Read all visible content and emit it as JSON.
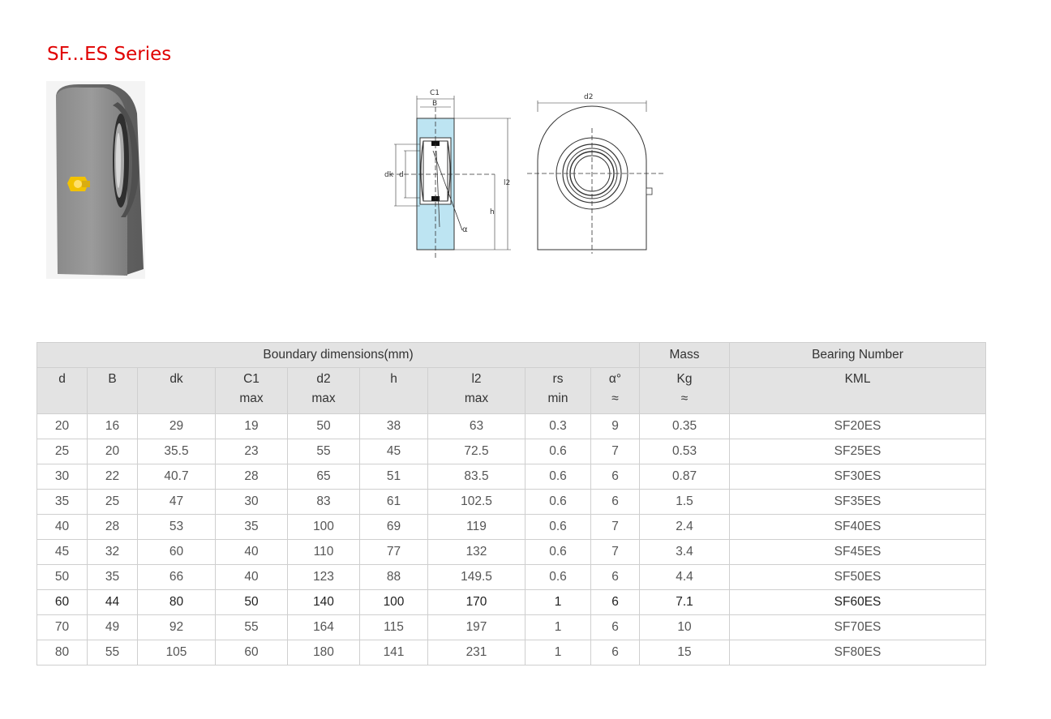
{
  "title": "SF...ES Series",
  "diagram": {
    "side_labels": {
      "c1": "C1",
      "b": "B",
      "dk": "dk",
      "d": "d",
      "l2": "l2",
      "h": "h",
      "alpha": "α"
    },
    "front_labels": {
      "d2": "d2"
    }
  },
  "table": {
    "group_headers": {
      "boundary": "Boundary dimensions(mm)",
      "mass": "Mass",
      "bearing": "Bearing Number"
    },
    "columns": [
      {
        "name": "d",
        "sub": ""
      },
      {
        "name": "B",
        "sub": ""
      },
      {
        "name": "dk",
        "sub": ""
      },
      {
        "name": "C1",
        "sub": "max"
      },
      {
        "name": "d2",
        "sub": "max"
      },
      {
        "name": "h",
        "sub": ""
      },
      {
        "name": "l2",
        "sub": "max"
      },
      {
        "name": "rs",
        "sub": "min"
      },
      {
        "name": "α°",
        "sub": "≈"
      },
      {
        "name": "Kg",
        "sub": "≈"
      },
      {
        "name": "KML",
        "sub": ""
      }
    ],
    "rows": [
      [
        "20",
        "16",
        "29",
        "19",
        "50",
        "38",
        "63",
        "0.3",
        "9",
        "0.35",
        "SF20ES"
      ],
      [
        "25",
        "20",
        "35.5",
        "23",
        "55",
        "45",
        "72.5",
        "0.6",
        "7",
        "0.53",
        "SF25ES"
      ],
      [
        "30",
        "22",
        "40.7",
        "28",
        "65",
        "51",
        "83.5",
        "0.6",
        "6",
        "0.87",
        "SF30ES"
      ],
      [
        "35",
        "25",
        "47",
        "30",
        "83",
        "61",
        "102.5",
        "0.6",
        "6",
        "1.5",
        "SF35ES"
      ],
      [
        "40",
        "28",
        "53",
        "35",
        "100",
        "69",
        "119",
        "0.6",
        "7",
        "2.4",
        "SF40ES"
      ],
      [
        "45",
        "32",
        "60",
        "40",
        "110",
        "77",
        "132",
        "0.6",
        "7",
        "3.4",
        "SF45ES"
      ],
      [
        "50",
        "35",
        "66",
        "40",
        "123",
        "88",
        "149.5",
        "0.6",
        "6",
        "4.4",
        "SF50ES"
      ],
      [
        "60",
        "44",
        "80",
        "50",
        "140",
        "100",
        "170",
        "1",
        "6",
        "7.1",
        "SF60ES"
      ],
      [
        "70",
        "49",
        "92",
        "55",
        "164",
        "115",
        "197",
        "1",
        "6",
        "10",
        "SF70ES"
      ],
      [
        "80",
        "55",
        "105",
        "60",
        "180",
        "141",
        "231",
        "1",
        "6",
        "15",
        "SF80ES"
      ]
    ]
  }
}
